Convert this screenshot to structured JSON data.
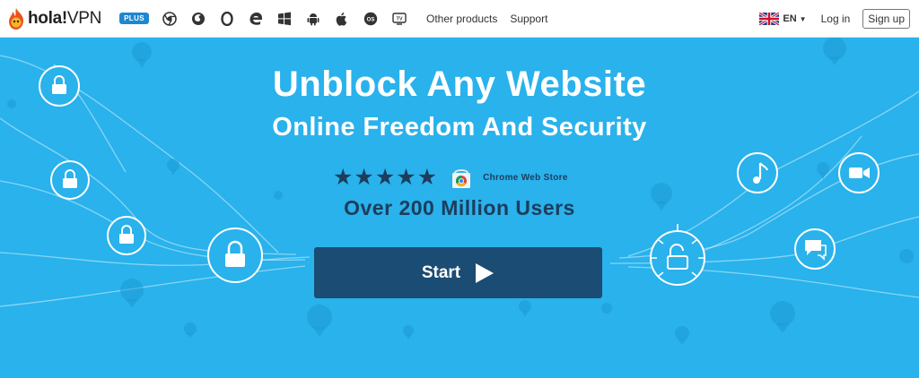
{
  "logo": {
    "brand": "hola!",
    "suffix": "VPN"
  },
  "plus_badge": "PLUS",
  "platforms": [
    "chrome-icon",
    "firefox-icon",
    "opera-icon",
    "edge-icon",
    "windows-icon",
    "android-icon",
    "apple-icon",
    "macos-icon",
    "tv-icon"
  ],
  "nav": {
    "other_products": "Other products",
    "support": "Support"
  },
  "lang": {
    "code": "EN"
  },
  "auth": {
    "login": "Log in",
    "signup": "Sign up"
  },
  "hero": {
    "title": "Unblock Any Website",
    "subtitle": "Online Freedom And Security",
    "rating_stars": "★★★★★",
    "store_label": "Chrome Web Store",
    "users": "Over 200 Million Users",
    "start_label": "Start"
  },
  "colors": {
    "hero_bg": "#29b2ec",
    "button_bg": "#1b4c73",
    "dark_text": "#1c3d5c",
    "plus_bg": "#1f87d0"
  }
}
